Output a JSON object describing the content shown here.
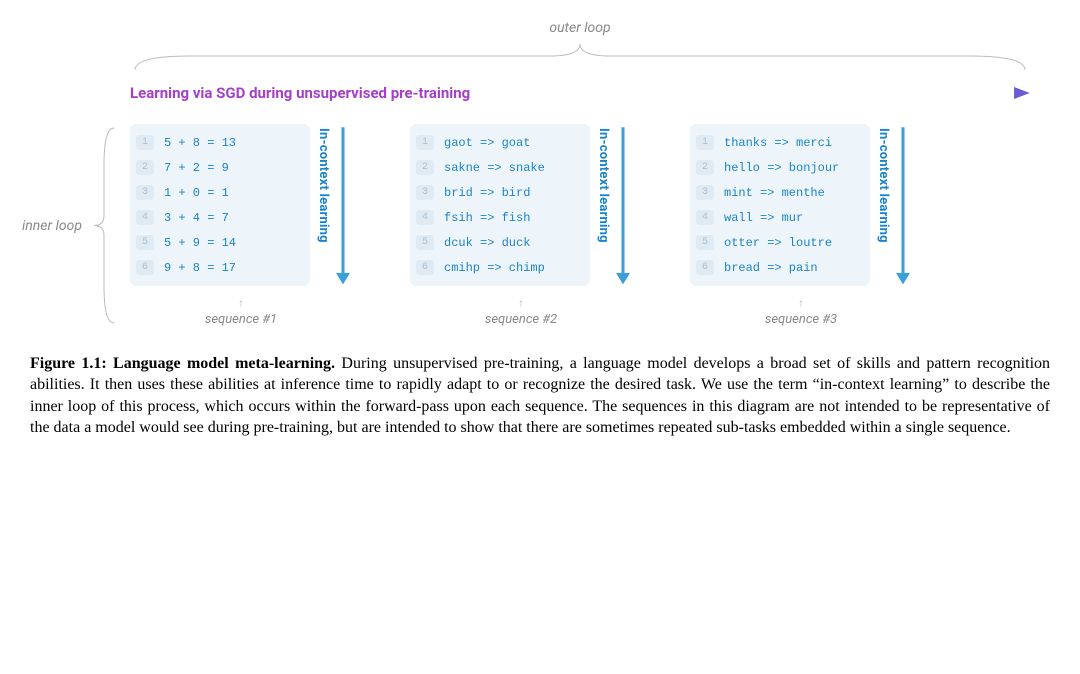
{
  "labels": {
    "outer_loop": "outer loop",
    "inner_loop": "inner loop",
    "sgd": "Learning via SGD during unsupervised pre-training",
    "in_context": "In-context learning",
    "seq_arrow": "↑"
  },
  "panels": [
    {
      "seq_label": "sequence #1",
      "rows": [
        "5 + 8 = 13",
        "7 + 2 = 9",
        "1 + 0 = 1",
        "3 + 4 = 7",
        "5 + 9 = 14",
        "9 + 8 = 17"
      ]
    },
    {
      "seq_label": "sequence #2",
      "rows": [
        "gaot => goat",
        "sakne => snake",
        "brid => bird",
        "fsih => fish",
        "dcuk => duck",
        "cmihp => chimp"
      ]
    },
    {
      "seq_label": "sequence #3",
      "rows": [
        "thanks => merci",
        "hello => bonjour",
        "mint => menthe",
        "wall => mur",
        "otter => loutre",
        "bread => pain"
      ]
    }
  ],
  "caption": {
    "title": "Figure 1.1: Language model meta-learning.",
    "body": "During unsupervised pre-training, a language model develops a broad set of skills and pattern recognition abilities. It then uses these abilities at inference time to rapidly adapt to or recognize the desired task. We use the term “in-context learning” to describe the inner loop of this process, which occurs within the forward-pass upon each sequence. The sequences in this diagram are not intended to be representative of the data a model would see during pre-training, but are intended to show that there are sometimes repeated sub-tasks embedded within a single sequence."
  },
  "colors": {
    "blue": "#1a84c9",
    "purple": "#a63ec9",
    "panel_bg": "#eef5fa"
  }
}
